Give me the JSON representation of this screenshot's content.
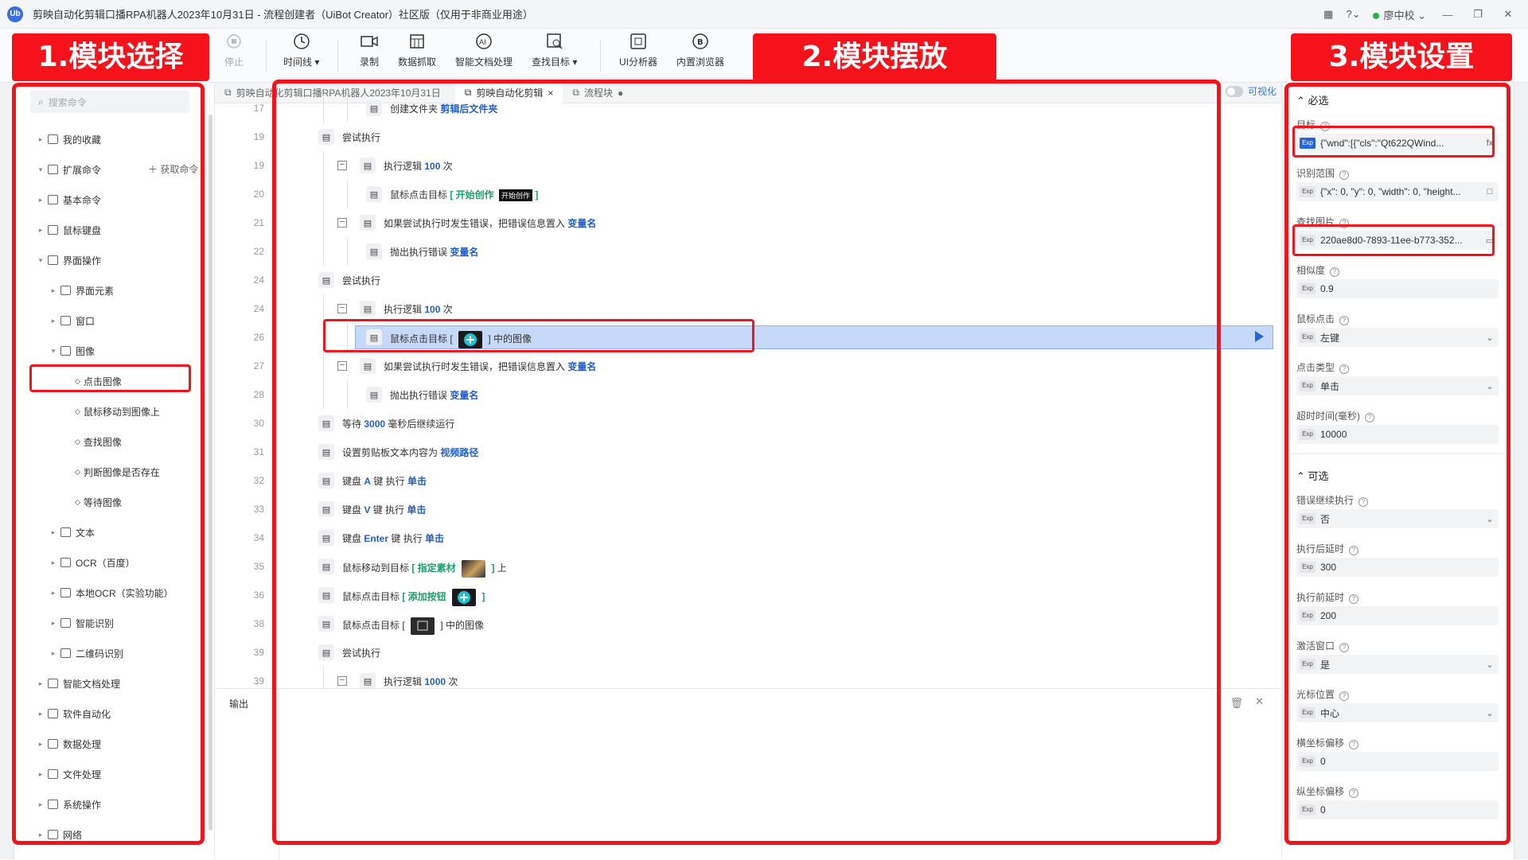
{
  "window": {
    "title": "剪映自动化剪辑口播RPA机器人2023年10月31日 - 流程创建者（UiBot Creator）社区版（仅用于非商业用途）",
    "user": "廖中校",
    "logo": "Ub"
  },
  "toolbar": {
    "stop": "停止",
    "timeline": "时间线",
    "record": "录制",
    "data_scrape": "数据抓取",
    "smart_doc": "智能文档处理",
    "find_target": "查找目标",
    "ui_analyzer": "UI分析器",
    "browser": "内置浏览器"
  },
  "annotations": {
    "left": "1.模块选择",
    "middle": "2.模块摆放",
    "right": "3.模块设置"
  },
  "sidebar": {
    "search_placeholder": "搜索命令",
    "get_command": "获取命令",
    "items": [
      {
        "label": "我的收藏",
        "level": 0,
        "arrow": "▸"
      },
      {
        "label": "扩展命令",
        "level": 0,
        "arrow": "▾"
      },
      {
        "label": "基本命令",
        "level": 0,
        "arrow": "▸"
      },
      {
        "label": "鼠标键盘",
        "level": 0,
        "arrow": "▸"
      },
      {
        "label": "界面操作",
        "level": 0,
        "arrow": "▾"
      },
      {
        "label": "界面元素",
        "level": 1,
        "arrow": "▸"
      },
      {
        "label": "窗口",
        "level": 1,
        "arrow": "▸"
      },
      {
        "label": "图像",
        "level": 1,
        "arrow": "▾"
      },
      {
        "label": "点击图像",
        "level": 2,
        "arrow": ""
      },
      {
        "label": "鼠标移动到图像上",
        "level": 2,
        "arrow": ""
      },
      {
        "label": "查找图像",
        "level": 2,
        "arrow": ""
      },
      {
        "label": "判断图像是否存在",
        "level": 2,
        "arrow": ""
      },
      {
        "label": "等待图像",
        "level": 2,
        "arrow": ""
      },
      {
        "label": "文本",
        "level": 1,
        "arrow": "▸"
      },
      {
        "label": "OCR（百度）",
        "level": 1,
        "arrow": "▸"
      },
      {
        "label": "本地OCR（实验功能）",
        "level": 1,
        "arrow": "▸"
      },
      {
        "label": "智能识别",
        "level": 1,
        "arrow": "▸"
      },
      {
        "label": "二维码识别",
        "level": 1,
        "arrow": "▸"
      },
      {
        "label": "智能文档处理",
        "level": 0,
        "arrow": "▸"
      },
      {
        "label": "软件自动化",
        "level": 0,
        "arrow": "▸"
      },
      {
        "label": "数据处理",
        "level": 0,
        "arrow": "▸"
      },
      {
        "label": "文件处理",
        "level": 0,
        "arrow": "▸"
      },
      {
        "label": "系统操作",
        "level": 0,
        "arrow": "▸"
      },
      {
        "label": "网络",
        "level": 0,
        "arrow": "▸"
      }
    ]
  },
  "tabs": [
    {
      "label": "剪映自动化剪辑口播RPA机器人2023年10月31日",
      "active": false,
      "close": ""
    },
    {
      "label": "剪映自动化剪辑",
      "active": true,
      "close": "×"
    },
    {
      "label": "流程块",
      "active": false,
      "close": "●"
    }
  ],
  "visualize_label": "可视化",
  "editor_rows": [
    {
      "ln": "17",
      "indent": 2,
      "parts": [
        {
          "t": "创建文件夹 "
        },
        {
          "t": "剪辑后文件夹",
          "c": "kw"
        }
      ],
      "collapse": false
    },
    {
      "ln": "19",
      "indent": 0,
      "parts": [
        {
          "t": "尝试执行"
        }
      ],
      "collapse": false
    },
    {
      "ln": "19",
      "indent": 1,
      "parts": [
        {
          "t": "执行逻辑 "
        },
        {
          "t": "100",
          "c": "kw"
        },
        {
          "t": " 次"
        }
      ],
      "collapse": true
    },
    {
      "ln": "20",
      "indent": 2,
      "parts": [
        {
          "t": "鼠标点击目标 "
        },
        {
          "t": "[ 开始创作 ",
          "c": "kg"
        },
        {
          "t": "开始创作",
          "c": "tag"
        },
        {
          "t": " ]",
          "c": "kg"
        }
      ],
      "collapse": false
    },
    {
      "ln": "21",
      "indent": 1,
      "parts": [
        {
          "t": "如果尝试执行时发生错误，把错误信息置入 "
        },
        {
          "t": "变量名",
          "c": "kw"
        }
      ],
      "collapse": true
    },
    {
      "ln": "22",
      "indent": 2,
      "parts": [
        {
          "t": "抛出执行错误 "
        },
        {
          "t": "变量名",
          "c": "kw"
        }
      ],
      "collapse": false
    },
    {
      "ln": "24",
      "indent": 0,
      "parts": [
        {
          "t": "尝试执行"
        }
      ],
      "collapse": false
    },
    {
      "ln": "24",
      "indent": 1,
      "parts": [
        {
          "t": "执行逻辑 "
        },
        {
          "t": "100",
          "c": "kw"
        },
        {
          "t": " 次"
        }
      ],
      "collapse": true
    },
    {
      "ln": "26",
      "indent": 2,
      "selected": true,
      "parts": [
        {
          "t": "鼠标点击目标 [ "
        },
        {
          "t": "",
          "c": "thumb-cyan"
        },
        {
          "t": " ] 中的图像"
        }
      ],
      "collapse": false
    },
    {
      "ln": "27",
      "indent": 1,
      "parts": [
        {
          "t": "如果尝试执行时发生错误，把错误信息置入 "
        },
        {
          "t": "变量名",
          "c": "kw"
        }
      ],
      "collapse": true
    },
    {
      "ln": "28",
      "indent": 2,
      "parts": [
        {
          "t": "抛出执行错误 "
        },
        {
          "t": "变量名",
          "c": "kw"
        }
      ],
      "collapse": false
    },
    {
      "ln": "30",
      "indent": 0,
      "parts": [
        {
          "t": "等待 "
        },
        {
          "t": "3000",
          "c": "kw"
        },
        {
          "t": " 毫秒后继续运行"
        }
      ],
      "collapse": false
    },
    {
      "ln": "31",
      "indent": 0,
      "parts": [
        {
          "t": "设置剪贴板文本内容为 "
        },
        {
          "t": "视频路径",
          "c": "kw"
        }
      ],
      "collapse": false
    },
    {
      "ln": "32",
      "indent": 0,
      "parts": [
        {
          "t": "键盘 "
        },
        {
          "t": "A",
          "c": "kw"
        },
        {
          "t": " 键 执行 "
        },
        {
          "t": "单击",
          "c": "kw"
        }
      ],
      "collapse": false
    },
    {
      "ln": "33",
      "indent": 0,
      "parts": [
        {
          "t": "键盘 "
        },
        {
          "t": "V",
          "c": "kw"
        },
        {
          "t": " 键 执行 "
        },
        {
          "t": "单击",
          "c": "kw"
        }
      ],
      "collapse": false
    },
    {
      "ln": "34",
      "indent": 0,
      "parts": [
        {
          "t": "键盘 "
        },
        {
          "t": "Enter",
          "c": "kw"
        },
        {
          "t": " 键 执行 "
        },
        {
          "t": "单击",
          "c": "kw"
        }
      ],
      "collapse": false
    },
    {
      "ln": "35",
      "indent": 0,
      "parts": [
        {
          "t": "鼠标移动到目标 "
        },
        {
          "t": "[ 指定素材 ",
          "c": "kg"
        },
        {
          "t": "",
          "c": "thumb-photo"
        },
        {
          "t": " ]",
          "c": "kg"
        },
        {
          "t": " 上"
        }
      ],
      "collapse": false
    },
    {
      "ln": "36",
      "indent": 0,
      "parts": [
        {
          "t": "鼠标点击目标 "
        },
        {
          "t": "[ 添加按钮 ",
          "c": "kg"
        },
        {
          "t": "",
          "c": "thumb-cyan"
        },
        {
          "t": " ]",
          "c": "kg"
        }
      ],
      "collapse": false
    },
    {
      "ln": "38",
      "indent": 0,
      "parts": [
        {
          "t": "鼠标点击目标 [ "
        },
        {
          "t": "",
          "c": "thumb-dark"
        },
        {
          "t": " ] 中的图像"
        }
      ],
      "collapse": false
    },
    {
      "ln": "39",
      "indent": 0,
      "parts": [
        {
          "t": "尝试执行"
        }
      ],
      "collapse": false
    },
    {
      "ln": "39",
      "indent": 1,
      "parts": [
        {
          "t": "执行逻辑 "
        },
        {
          "t": "1000",
          "c": "kw"
        },
        {
          "t": " 次"
        }
      ],
      "collapse": true
    }
  ],
  "output": {
    "label": "输出"
  },
  "props": {
    "required_title": "必选",
    "optional_title": "可选",
    "fields": [
      {
        "label": "目标",
        "value": "{\"wnd\":[{\"cls\":\"Qt622QWind...",
        "exp_blue": true,
        "icon": "fx"
      },
      {
        "label": "识别范围",
        "value": "{\"x\": 0, \"y\": 0, \"width\": 0, \"height...",
        "icon": "□"
      },
      {
        "label": "查找图片",
        "value": "220ae8d0-7893-11ee-b773-352...",
        "icon": "▭"
      },
      {
        "label": "相似度",
        "value": "0.9",
        "icon": ""
      },
      {
        "label": "鼠标点击",
        "value": "左键",
        "icon": "⌄"
      },
      {
        "label": "点击类型",
        "value": "单击",
        "icon": "⌄"
      },
      {
        "label": "超时时间(毫秒)",
        "value": "10000",
        "icon": ""
      }
    ],
    "optional_fields": [
      {
        "label": "错误继续执行",
        "value": "否",
        "icon": "⌄"
      },
      {
        "label": "执行后延时",
        "value": "300",
        "icon": ""
      },
      {
        "label": "执行前延时",
        "value": "200",
        "icon": ""
      },
      {
        "label": "激活窗口",
        "value": "是",
        "icon": "⌄"
      },
      {
        "label": "光标位置",
        "value": "中心",
        "icon": "⌄"
      },
      {
        "label": "横坐标偏移",
        "value": "0",
        "icon": ""
      },
      {
        "label": "纵坐标偏移",
        "value": "0",
        "icon": ""
      }
    ]
  },
  "colors": {
    "annotation_red": "#f5121a",
    "accent_blue": "#2566d6",
    "keyword_green": "#1aa06a"
  }
}
